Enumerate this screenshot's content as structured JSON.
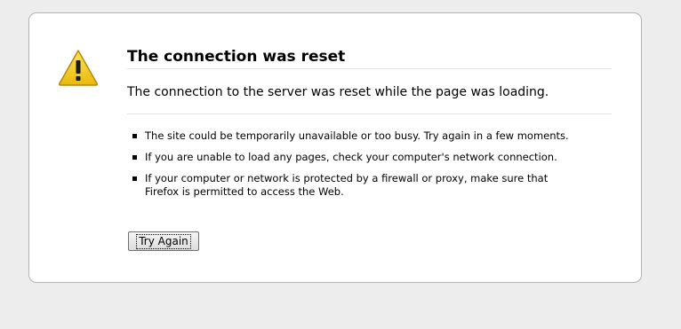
{
  "error": {
    "title": "The connection was reset",
    "description": "The connection to the server was reset while the page was loading.",
    "tips": [
      "The site could be temporarily unavailable or too busy. Try again in a few moments.",
      "If you are unable to load any pages, check your computer's network connection.",
      "If your computer or network is protected by a firewall or proxy, make sure that Firefox is permitted to access the Web."
    ],
    "try_again_label": "Try Again",
    "icon": "warning-icon"
  },
  "colors": {
    "page_background": "#ededed",
    "box_background": "#ffffff",
    "box_border": "#b3b3b3",
    "warning_yellow": "#f7d417"
  }
}
